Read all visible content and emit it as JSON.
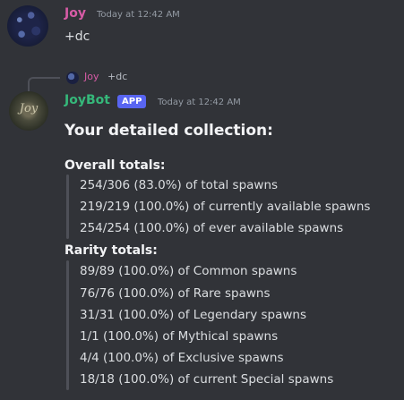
{
  "messages": {
    "user": {
      "author": "Joy",
      "timestamp": "Today at 12:42 AM",
      "content": "+dc"
    },
    "bot": {
      "reply_to": {
        "author": "Joy",
        "content": "+dc"
      },
      "author": "JoyBot",
      "badge": "APP",
      "timestamp": "Today at 12:42 AM",
      "heading": "Your detailed collection:",
      "overall": {
        "title": "Overall totals:",
        "lines": [
          "254/306 (83.0%) of total spawns",
          "219/219 (100.0%) of currently available spawns",
          "254/254 (100.0%) of ever available spawns"
        ]
      },
      "rarity": {
        "title": "Rarity totals:",
        "lines": [
          "89/89 (100.0%) of Common spawns",
          "76/76 (100.0%) of Rare spawns",
          "31/31 (100.0%) of Legendary spawns",
          "1/1 (100.0%) of Mythical spawns",
          "4/4 (100.0%) of Exclusive spawns",
          "18/18 (100.0%) of current Special spawns"
        ]
      }
    }
  },
  "colors": {
    "background": "#313338",
    "user_name": "#d75ba6",
    "bot_name": "#35b87a",
    "app_badge": "#5865f2"
  }
}
